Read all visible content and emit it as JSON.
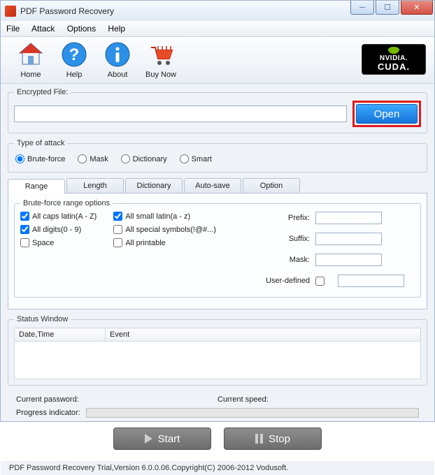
{
  "window": {
    "title": "PDF Password Recovery"
  },
  "menu": {
    "file": "File",
    "attack": "Attack",
    "options": "Options",
    "help": "Help"
  },
  "toolbar": {
    "home": "Home",
    "help": "Help",
    "about": "About",
    "buynow": "Buy Now",
    "cuda_brand": "NVIDIA.",
    "cuda_label": "CUDA."
  },
  "file": {
    "legend": "Encrypted File:",
    "value": "",
    "open_label": "Open"
  },
  "attack": {
    "legend": "Type of attack",
    "bruteforce": "Brute-force",
    "mask": "Mask",
    "dictionary": "Dictionary",
    "smart": "Smart"
  },
  "tabs": {
    "range": "Range",
    "length": "Length",
    "dictionary": "Dictionary",
    "autosave": "Auto-save",
    "option": "Option"
  },
  "range": {
    "legend": "Brute-force range options",
    "caps": "All caps latin(A - Z)",
    "small": "All small latin(a - z)",
    "digits": "All digits(0 - 9)",
    "special": "All special symbols(!@#...)",
    "space": "Space",
    "printable": "All printable",
    "prefix": "Prefix:",
    "suffix": "Suffix:",
    "mask": "Mask:",
    "userdef": "User-defined"
  },
  "status": {
    "legend": "Status Window",
    "col_datetime": "Date,Time",
    "col_event": "Event"
  },
  "current": {
    "password_label": "Current password:",
    "password_value": "",
    "speed_label": "Current speed:",
    "speed_value": ""
  },
  "progress": {
    "label": "Progress indicator:"
  },
  "buttons": {
    "start": "Start",
    "stop": "Stop"
  },
  "footer": {
    "text": "PDF Password Recovery Trial,Version 6.0.0.06.Copyright(C) 2006-2012 Vodusoft."
  }
}
